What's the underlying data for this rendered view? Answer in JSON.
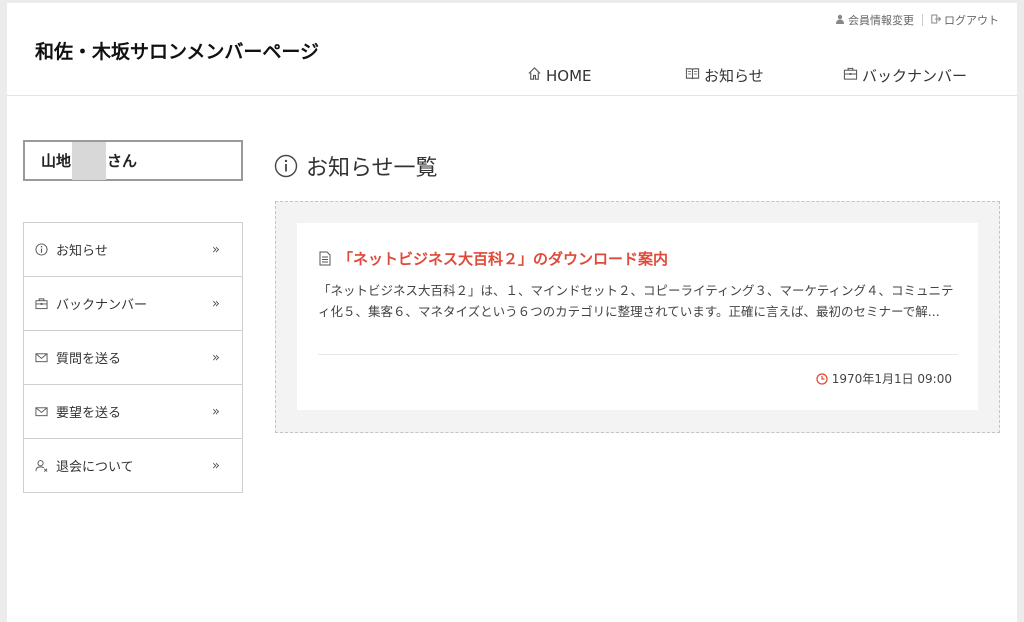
{
  "header": {
    "site_title": "和佐・木坂サロンメンバーページ",
    "top_links": [
      {
        "label": "会員情報変更",
        "icon": "user-icon"
      },
      {
        "label": "ログアウト",
        "icon": "logout-icon"
      }
    ],
    "nav": [
      {
        "label": "HOME",
        "icon": "home-icon"
      },
      {
        "label": "お知らせ",
        "icon": "book-icon"
      },
      {
        "label": "バックナンバー",
        "icon": "briefcase-icon"
      }
    ]
  },
  "sidebar": {
    "user_name_prefix": "山地",
    "user_name_suffix": "さん",
    "menu": [
      {
        "label": "お知らせ",
        "icon": "info-icon"
      },
      {
        "label": "バックナンバー",
        "icon": "briefcase-icon"
      },
      {
        "label": "質問を送る",
        "icon": "mail-icon"
      },
      {
        "label": "要望を送る",
        "icon": "mail-icon"
      },
      {
        "label": "退会について",
        "icon": "user-remove-icon"
      }
    ],
    "chevron": "»"
  },
  "main": {
    "heading": "お知らせ一覧",
    "notices": [
      {
        "title": "「ネットビジネス大百科２」のダウンロード案内",
        "excerpt": "「ネットビジネス大百科２」は、１、マインドセット２、コピーライティング３、マーケティング４、コミュニティ化５、集客６、マネタイズという６つのカテゴリに整理されています。正確に言えば、最初のセミナーで解...",
        "date": "1970年1月1日 09:00"
      }
    ]
  },
  "colors": {
    "accent": "#e04a3a",
    "background": "#ececec",
    "border": "#cfcfcf"
  }
}
